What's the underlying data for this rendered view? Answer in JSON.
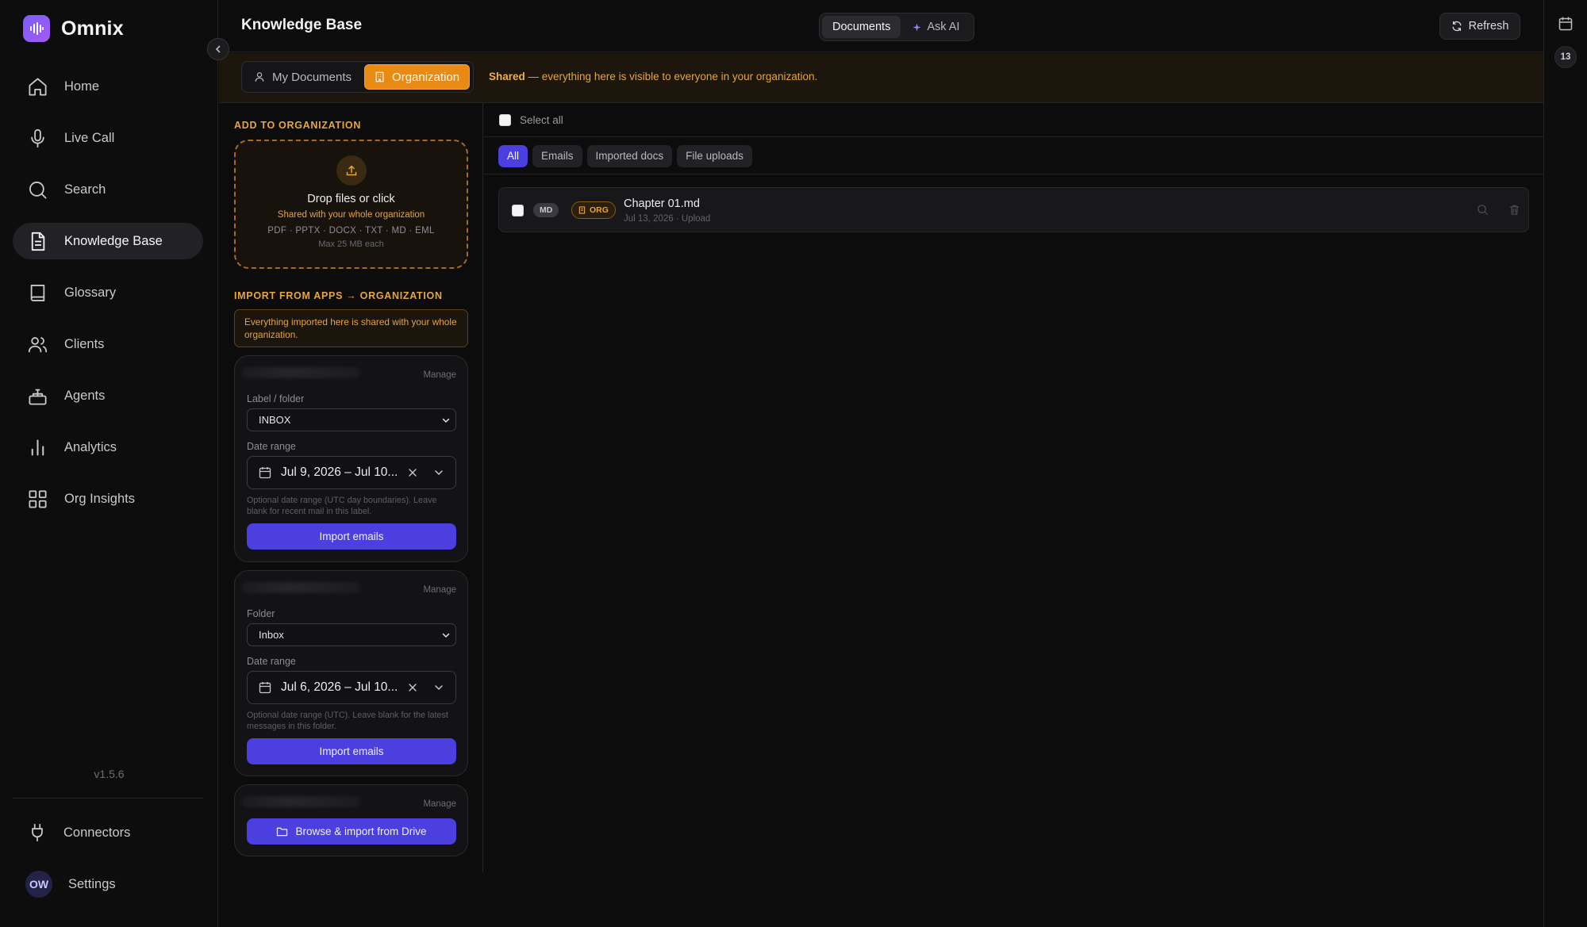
{
  "app": {
    "name": "Omnix",
    "version": "v1.5.6"
  },
  "sidebar": {
    "items": [
      {
        "label": "Home",
        "icon": "home-icon"
      },
      {
        "label": "Live Call",
        "icon": "microphone-icon"
      },
      {
        "label": "Search",
        "icon": "search-icon"
      },
      {
        "label": "Knowledge Base",
        "icon": "document-icon",
        "active": true
      },
      {
        "label": "Glossary",
        "icon": "book-icon"
      },
      {
        "label": "Clients",
        "icon": "users-icon"
      },
      {
        "label": "Agents",
        "icon": "robot-icon"
      },
      {
        "label": "Analytics",
        "icon": "bar-chart-icon"
      },
      {
        "label": "Org Insights",
        "icon": "grid-icon"
      }
    ],
    "bottom": {
      "connectors_label": "Connectors",
      "settings_label": "Settings",
      "avatar_initials": "OW"
    }
  },
  "header": {
    "title": "Knowledge Base",
    "tabs": [
      {
        "label": "Documents",
        "active": true
      },
      {
        "label": "Ask AI",
        "active": false
      }
    ],
    "refresh_label": "Refresh"
  },
  "rail": {
    "badge": "13"
  },
  "scope": {
    "tabs": [
      {
        "label": "My Documents",
        "active": false
      },
      {
        "label": "Organization",
        "active": true
      }
    ],
    "note_strong": "Shared",
    "note_text": " — everything here is visible to everyone in your organization."
  },
  "upload": {
    "section_label": "ADD TO ORGANIZATION",
    "title": "Drop files or click",
    "subtitle": "Shared with your whole organization",
    "types": "PDF · PPTX · DOCX · TXT · MD · EML",
    "max": "Max 25 MB each"
  },
  "import": {
    "section_label": "IMPORT FROM APPS → ORGANIZATION",
    "note": "Everything imported here is shared with your whole organization.",
    "cards": [
      {
        "manage": "Manage",
        "folder_label": "Label / folder",
        "folder_value": "INBOX",
        "date_label": "Date range",
        "date_value": "Jul 9, 2026 – Jul 10...",
        "hint": "Optional date range (UTC day boundaries). Leave blank for recent mail in this label.",
        "button": "Import emails"
      },
      {
        "manage": "Manage",
        "folder_label": "Folder",
        "folder_value": "Inbox",
        "date_label": "Date range",
        "date_value": "Jul 6, 2026 – Jul 10...",
        "hint": "Optional date range (UTC). Leave blank for the latest messages in this folder.",
        "button": "Import emails"
      },
      {
        "manage": "Manage",
        "button": "Browse & import from Drive"
      }
    ]
  },
  "documents": {
    "select_all_label": "Select all",
    "filters": [
      {
        "label": "All",
        "active": true
      },
      {
        "label": "Emails",
        "active": false
      },
      {
        "label": "Imported docs",
        "active": false
      },
      {
        "label": "File uploads",
        "active": false
      }
    ],
    "rows": [
      {
        "type_badge": "MD",
        "scope_badge": "ORG",
        "name": "Chapter 01.md",
        "meta": "Jul 13, 2026 · Upload"
      }
    ]
  },
  "colors": {
    "accent": "#4b3fe0",
    "org_orange": "#e98a15",
    "org_text": "#e7a73a",
    "background": "#0c0c0d"
  }
}
